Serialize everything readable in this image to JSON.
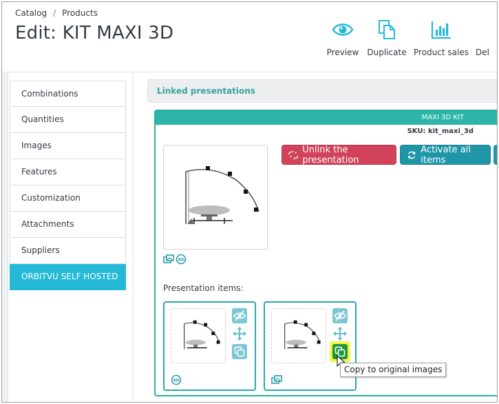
{
  "breadcrumb": {
    "catalog": "Catalog",
    "separator": "/",
    "products": "Products"
  },
  "page_title": "Edit: KIT MAXI 3D",
  "toolbar": {
    "preview": "Preview",
    "duplicate": "Duplicate",
    "product_sales": "Product sales",
    "delete_partial": "Del"
  },
  "sidebar": {
    "items": [
      {
        "label": "Combinations"
      },
      {
        "label": "Quantities"
      },
      {
        "label": "Images"
      },
      {
        "label": "Features"
      },
      {
        "label": "Customization"
      },
      {
        "label": "Attachments"
      },
      {
        "label": "Suppliers"
      },
      {
        "label": "ORBITVU SELF HOSTED",
        "active": true
      }
    ]
  },
  "main": {
    "panel_title": "Linked presentations",
    "product_name": "MAXI 3D KIT",
    "sku": "SKU: kit_maxi_3d",
    "unlink_button": "Unlink the presentation",
    "activate_button": "Activate all items",
    "items_label": "Presentation items:"
  },
  "tooltip": "Copy to original images",
  "colors": {
    "accent": "#25b9d7",
    "teal": "#2cb5a8",
    "danger": "#d0435a",
    "action_blue": "#1f96a8",
    "highlight": "#f6f34a",
    "copy_green": "#1c9a3b"
  },
  "icons": {
    "preview": "eye-icon",
    "duplicate": "copy-icon",
    "sales": "bar-chart-icon",
    "unlink": "unlink-icon",
    "activate": "refresh-icon",
    "hide": "eye-slash-icon",
    "move": "move-arrows-icon",
    "copy": "copy-icon",
    "view360": "360-icon",
    "images": "images-icon"
  }
}
